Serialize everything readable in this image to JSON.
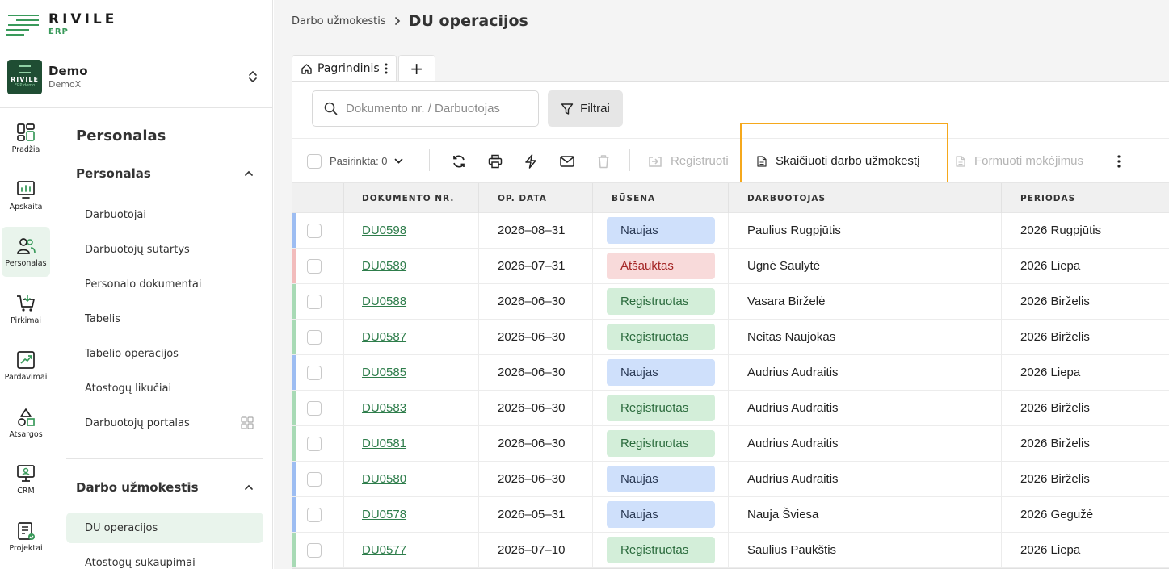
{
  "brand": {
    "name": "RIVILE",
    "sub": "ERP"
  },
  "company": {
    "name": "Demo",
    "code": "DemoX",
    "avatar_text": "RIVILE",
    "avatar_sub": "ERP demo"
  },
  "rail": [
    {
      "label": "Pradžia",
      "icon": "dashboard-icon"
    },
    {
      "label": "Apskaita",
      "icon": "accounting-chart-icon"
    },
    {
      "label": "Personalas",
      "icon": "people-icon",
      "active": true
    },
    {
      "label": "Pirkimai",
      "icon": "cart-icon"
    },
    {
      "label": "Pardavimai",
      "icon": "sales-growth-icon"
    },
    {
      "label": "Atsargos",
      "icon": "shapes-icon"
    },
    {
      "label": "CRM",
      "icon": "crm-monitor-icon"
    },
    {
      "label": "Projektai",
      "icon": "project-list-icon"
    }
  ],
  "subnav": {
    "title": "Personalas",
    "group1": "Personalas",
    "group1_items": [
      "Darbuotojai",
      "Darbuotojų sutartys",
      "Personalo dokumentai",
      "Tabelis",
      "Tabelio operacijos",
      "Atostogų likučiai",
      "Darbuotojų portalas"
    ],
    "group2": "Darbo užmokestis",
    "group2_items": [
      "DU operacijos",
      "Atostogų sukaupimai"
    ]
  },
  "breadcrumb": {
    "parent": "Darbo užmokestis",
    "current": "DU operacijos"
  },
  "tabs": {
    "main": "Pagrindinis",
    "add": "+"
  },
  "search": {
    "placeholder": "Dokumento nr. / Darbuotojas",
    "value": ""
  },
  "filter_label": "Filtrai",
  "toolbar": {
    "selected": "Pasirinkta: 0",
    "register": "Registruoti",
    "calculate": "Skaičiuoti darbo užmokestį",
    "payments": "Formuoti mokėjimus"
  },
  "colors": {
    "accent": "#2e7d4b",
    "highlight": "#f5a81c",
    "naujas": "#cfe0fb",
    "atsauktas": "#f8dada",
    "registruotas": "#d3eed9"
  },
  "table": {
    "headers": [
      "DOKUMENTO NR.",
      "OP. DATA",
      "BŪSENA",
      "DARBUOTOJAS",
      "PERIODAS"
    ],
    "rows": [
      {
        "doc": "DU0598",
        "date": "2026–08–31",
        "status": "Naujas",
        "kind": "naujas",
        "employee": "Paulius Rugpjūtis",
        "period": "2026 Rugpjūtis"
      },
      {
        "doc": "DU0589",
        "date": "2026–07–31",
        "status": "Atšauktas",
        "kind": "ats",
        "employee": "Ugnė Saulytė",
        "period": "2026 Liepa"
      },
      {
        "doc": "DU0588",
        "date": "2026–06–30",
        "status": "Registruotas",
        "kind": "reg",
        "employee": "Vasara Birželė",
        "period": "2026 Birželis"
      },
      {
        "doc": "DU0587",
        "date": "2026–06–30",
        "status": "Registruotas",
        "kind": "reg",
        "employee": "Neitas Naujokas",
        "period": "2026 Birželis"
      },
      {
        "doc": "DU0585",
        "date": "2026–06–30",
        "status": "Naujas",
        "kind": "naujas",
        "employee": "Audrius Audraitis",
        "period": "2026 Liepa"
      },
      {
        "doc": "DU0583",
        "date": "2026–06–30",
        "status": "Registruotas",
        "kind": "reg",
        "employee": "Audrius Audraitis",
        "period": "2026 Birželis"
      },
      {
        "doc": "DU0581",
        "date": "2026–06–30",
        "status": "Registruotas",
        "kind": "reg",
        "employee": "Audrius Audraitis",
        "period": "2026 Birželis"
      },
      {
        "doc": "DU0580",
        "date": "2026–06–30",
        "status": "Naujas",
        "kind": "naujas",
        "employee": "Audrius Audraitis",
        "period": "2026 Birželis"
      },
      {
        "doc": "DU0578",
        "date": "2026–05–31",
        "status": "Naujas",
        "kind": "naujas",
        "employee": "Nauja Šviesa",
        "period": "2026 Gegužė"
      },
      {
        "doc": "DU0577",
        "date": "2026–07–10",
        "status": "Registruotas",
        "kind": "reg",
        "employee": "Saulius Paukštis",
        "period": "2026 Liepa"
      }
    ]
  }
}
